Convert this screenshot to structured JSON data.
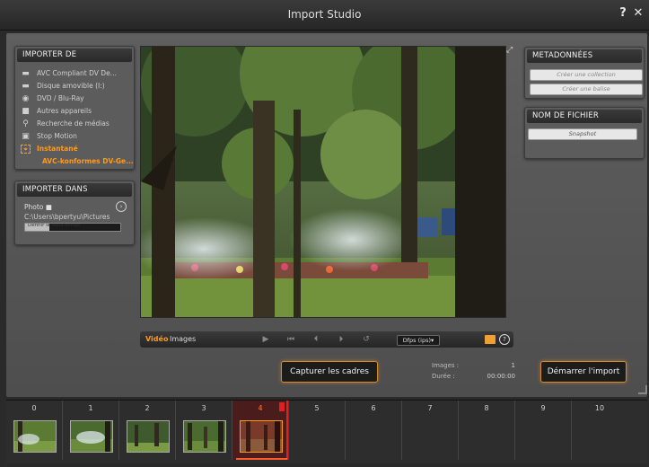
{
  "window": {
    "title": "Import Studio",
    "help_icon": "?",
    "close_icon": "✕"
  },
  "import_from": {
    "header": "IMPORTER DE",
    "items": [
      {
        "label": "AVC Compliant DV De...",
        "icon": "camcorder-icon"
      },
      {
        "label": "Disque amovible (I:)",
        "icon": "drive-icon"
      },
      {
        "label": "DVD / Blu-Ray",
        "icon": "disc-icon"
      },
      {
        "label": "Autres appareils",
        "icon": "folder-icon"
      },
      {
        "label": "Recherche de médias",
        "icon": "magnifier-icon"
      },
      {
        "label": "Stop Motion",
        "icon": "stop-motion-icon"
      },
      {
        "label": "Instantané",
        "icon": "snapshot-icon",
        "active": true
      }
    ],
    "active_device": "AVC-konformes DV-Ge..."
  },
  "import_to": {
    "header": "IMPORTER DANS",
    "label": "Photo",
    "path": "C:\\Users\\bpertyu\\Pictures",
    "bar_text": "Définir le sous-fichier",
    "usage_fraction": 0.25
  },
  "metadata": {
    "header": "METADONNÉES",
    "create_collection": "Créer une collection",
    "create_tag": "Créer une balise"
  },
  "filename": {
    "header": "NOM DE FICHIER",
    "value": "Snapshot"
  },
  "transport": {
    "tab_video": "Vidéo",
    "tab_images": "Images",
    "fps": "Dfps (ips)▾"
  },
  "buttons": {
    "capture": "Capturer les cadres",
    "start_import": "Démarrer l'import"
  },
  "stats": {
    "images_label": "Images :",
    "images_value": "1",
    "duration_label": "Durée :",
    "duration_value": "00:00:00"
  },
  "filmstrip": {
    "selected_index": 4,
    "slots": [
      "0",
      "1",
      "2",
      "3",
      "4",
      "5",
      "6",
      "7",
      "8",
      "9",
      "10"
    ]
  },
  "colors": {
    "accent": "#ff9a1e",
    "playhead": "#e02020"
  }
}
